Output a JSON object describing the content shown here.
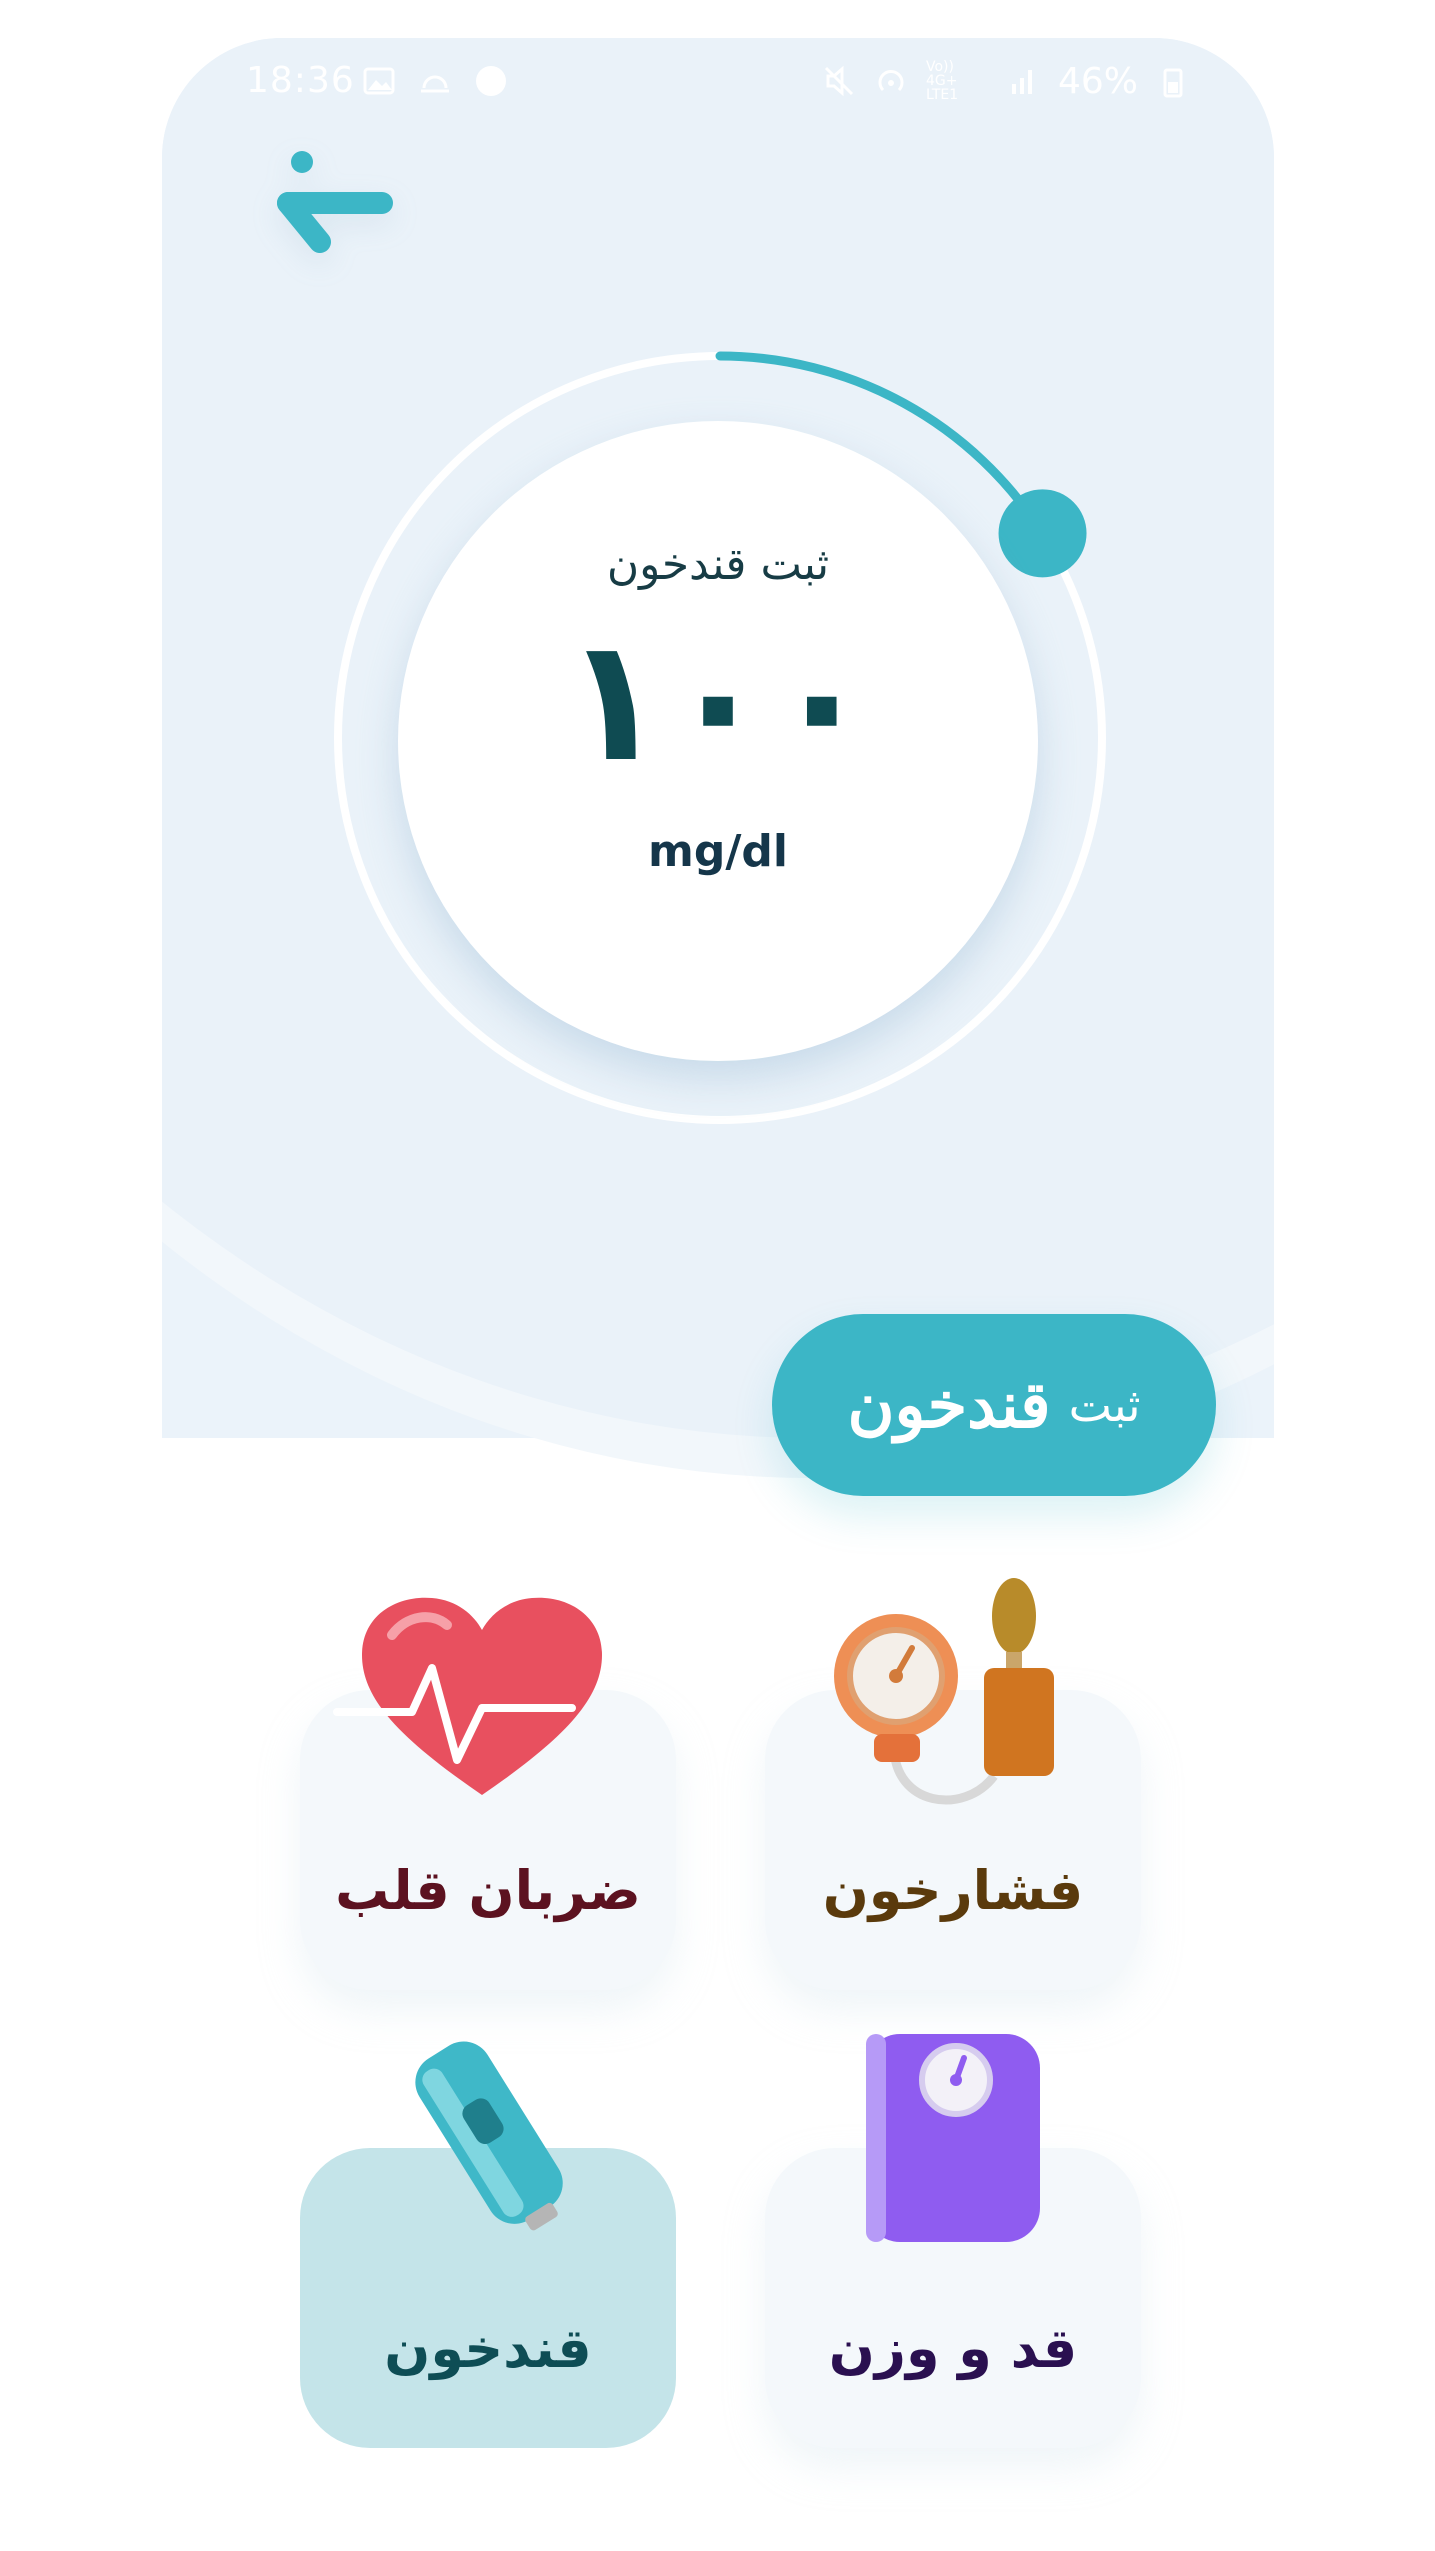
{
  "status_bar": {
    "time": "18:36",
    "battery": "46%",
    "network_label": "Vo)) 4G+ LTE1"
  },
  "gauge": {
    "title": "ثبت قندخون",
    "value": "۱۰۰",
    "unit": "mg/dl",
    "level": 0.16
  },
  "submit_button": {
    "small": "ثبت",
    "large": "قندخون"
  },
  "tiles": [
    {
      "label": "ضربان قلب",
      "color": "#5c1220",
      "icon": "heart-icon"
    },
    {
      "label": "فشارخون",
      "color": "#5a3a0c",
      "icon": "blood-pressure-icon"
    },
    {
      "label": "قندخون",
      "color": "#0e4d55",
      "icon": "glucometer-icon",
      "active": true
    },
    {
      "label": "قد و وزن",
      "color": "#2a1050",
      "icon": "scale-icon"
    }
  ],
  "colors": {
    "accent": "#3cb6c6",
    "background": "#ebf3fa",
    "value": "#0f4b52"
  }
}
